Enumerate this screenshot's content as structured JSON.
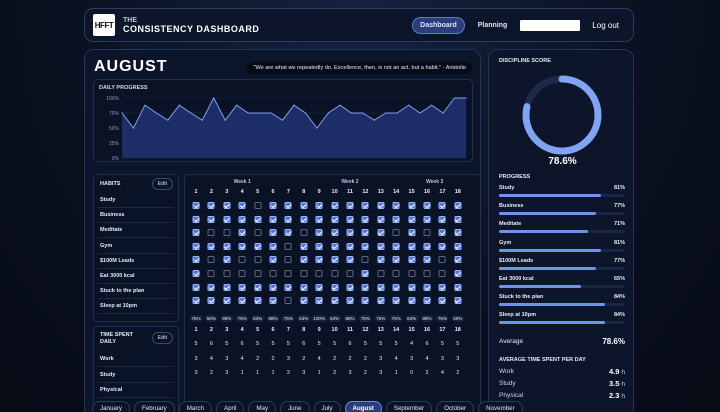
{
  "header": {
    "logo_text": "HFFT",
    "brand_top": "THE",
    "brand_name": "CONSISTENCY DASHBOARD",
    "nav": [
      "Dashboard",
      "Planning"
    ],
    "logout": "Log out"
  },
  "month_title": "AUGUST",
  "quote": "\"We are what we repeatedly do. Excellence, then, is not an act, but a habit.\" - Aristotle",
  "daily_progress": {
    "title": "DAILY PROGRESS",
    "y_ticks": [
      "100%",
      "75%",
      "50%",
      "25%",
      "0%"
    ]
  },
  "chart_data": {
    "type": "area",
    "title": "DAILY PROGRESS",
    "ylim": [
      0,
      100
    ],
    "y_ticks": [
      "100%",
      "75%",
      "50%",
      "25%",
      "0%"
    ],
    "x": [
      1,
      2,
      3,
      4,
      5,
      6,
      7,
      8,
      9,
      10,
      11,
      12,
      13,
      14,
      15,
      16,
      17,
      18,
      19,
      20,
      21,
      22,
      23,
      24,
      25,
      26,
      27,
      28,
      29,
      30,
      31
    ],
    "values": [
      75,
      50,
      88,
      75,
      63,
      88,
      75,
      63,
      100,
      63,
      88,
      75,
      75,
      75,
      63,
      88,
      75,
      50,
      75,
      88,
      75,
      75,
      63,
      75,
      75,
      88,
      75,
      88,
      75,
      100,
      100
    ],
    "fill": "#1f3170",
    "line": "#7fa0f0"
  },
  "habits": {
    "title": "HABITS",
    "edit": "Edit",
    "items": [
      "Study",
      "Business",
      "Meditate",
      "Gym",
      "$100M Leads",
      "Eat 3000 kcal",
      "Stuck to the plan",
      "Sleep at 10pm"
    ]
  },
  "time_spent": {
    "title_line1": "TIME SPENT",
    "title_line2": "DAILY",
    "edit": "Edit",
    "items": [
      "Work",
      "Study",
      "Physical"
    ]
  },
  "grid": {
    "weeks": [
      "Week 1",
      "Week 2",
      "Week 3"
    ],
    "days": [
      "1",
      "2",
      "3",
      "4",
      "5",
      "6",
      "7",
      "8",
      "9",
      "10",
      "11",
      "12",
      "13",
      "14",
      "15",
      "16",
      "17",
      "18"
    ],
    "checks": [
      [
        1,
        1,
        1,
        1,
        0,
        1,
        1,
        1,
        1,
        1,
        1,
        1,
        1,
        1,
        1,
        1,
        1,
        1
      ],
      [
        1,
        1,
        1,
        1,
        1,
        1,
        1,
        1,
        1,
        1,
        1,
        1,
        1,
        1,
        1,
        1,
        1,
        1
      ],
      [
        1,
        0,
        0,
        1,
        0,
        1,
        1,
        0,
        1,
        1,
        1,
        1,
        1,
        0,
        1,
        0,
        1,
        1
      ],
      [
        1,
        1,
        1,
        1,
        1,
        1,
        0,
        1,
        1,
        1,
        1,
        1,
        1,
        1,
        1,
        1,
        1,
        1
      ],
      [
        1,
        0,
        1,
        0,
        0,
        1,
        0,
        1,
        1,
        1,
        1,
        0,
        1,
        1,
        1,
        1,
        0,
        1
      ],
      [
        1,
        0,
        0,
        0,
        0,
        0,
        0,
        0,
        0,
        0,
        0,
        1,
        0,
        0,
        0,
        0,
        0,
        1
      ],
      [
        1,
        1,
        1,
        1,
        1,
        1,
        1,
        1,
        1,
        1,
        1,
        1,
        1,
        1,
        1,
        1,
        1,
        1
      ],
      [
        1,
        1,
        1,
        1,
        1,
        1,
        0,
        1,
        1,
        1,
        1,
        1,
        1,
        1,
        1,
        1,
        1,
        1
      ]
    ],
    "percents": [
      "75%",
      "50%",
      "88%",
      "75%",
      "63%",
      "88%",
      "75%",
      "63%",
      "100%",
      "63%",
      "88%",
      "75%",
      "75%",
      "75%",
      "63%",
      "88%",
      "75%",
      "50%"
    ],
    "time_days": [
      "1",
      "2",
      "3",
      "4",
      "5",
      "6",
      "7",
      "8",
      "9",
      "10",
      "11",
      "12",
      "13",
      "14",
      "15",
      "16",
      "17",
      "18"
    ],
    "time_rows": [
      [
        "5",
        "6",
        "5",
        "6",
        "5",
        "5",
        "5",
        "6",
        "5",
        "5",
        "6",
        "5",
        "5",
        "5",
        "4",
        "6",
        "5",
        "5"
      ],
      [
        "3",
        "4",
        "3",
        "4",
        "2",
        "2",
        "3",
        "2",
        "4",
        "2",
        "2",
        "2",
        "3",
        "4",
        "3",
        "4",
        "3",
        "3"
      ],
      [
        "3",
        "2",
        "3",
        "1",
        "1",
        "1",
        "2",
        "3",
        "1",
        "2",
        "3",
        "2",
        "3",
        "1",
        "0",
        "2",
        "4",
        "2"
      ]
    ]
  },
  "sidebar": {
    "score_title": "DISCIPLINE SCORE",
    "score": "78.6%",
    "score_fraction": 0.786,
    "progress_title": "PROGRESS",
    "progress": [
      {
        "label": "Study",
        "value": "81%",
        "frac": 0.81
      },
      {
        "label": "Business",
        "value": "77%",
        "frac": 0.77
      },
      {
        "label": "Meditate",
        "value": "71%",
        "frac": 0.71
      },
      {
        "label": "Gym",
        "value": "81%",
        "frac": 0.81
      },
      {
        "label": "$100M Leads",
        "value": "77%",
        "frac": 0.77
      },
      {
        "label": "Eat 3000 kcal",
        "value": "65%",
        "frac": 0.65
      },
      {
        "label": "Stuck to the plan",
        "value": "84%",
        "frac": 0.84
      },
      {
        "label": "Sleep at 10pm",
        "value": "84%",
        "frac": 0.84
      }
    ],
    "average_label": "Average",
    "average_value": "78.6%",
    "avg_time_title": "AVERAGE TIME SPENT PER DAY",
    "avg_time": [
      {
        "label": "Work",
        "value": "4.9",
        "unit": "h"
      },
      {
        "label": "Study",
        "value": "3.5",
        "unit": "h"
      },
      {
        "label": "Physical",
        "value": "2.3",
        "unit": "h"
      }
    ]
  },
  "months": [
    "January",
    "February",
    "March",
    "April",
    "May",
    "June",
    "July",
    "August",
    "September",
    "October",
    "November"
  ],
  "active_month": "August"
}
